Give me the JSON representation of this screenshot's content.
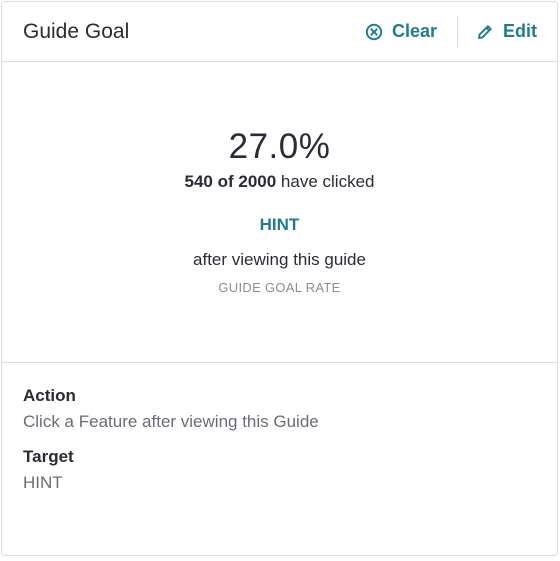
{
  "header": {
    "title": "Guide Goal",
    "clear_label": "Clear",
    "edit_label": "Edit"
  },
  "summary": {
    "rate": "27.0%",
    "clicked_count": "540 of 2000",
    "clicked_suffix": " have clicked",
    "feature": "HINT",
    "after_text": "after viewing this guide",
    "goal_label": "GUIDE GOAL RATE"
  },
  "details": {
    "action_label": "Action",
    "action_value": "Click a Feature after viewing this Guide",
    "target_label": "Target",
    "target_value": "HINT"
  },
  "colors": {
    "accent": "#1f7c8c",
    "border": "#dadce5",
    "text": "#2a2c35",
    "muted": "#8a8d97"
  },
  "icons": {
    "clear": "circle-x-icon",
    "edit": "pencil-icon"
  }
}
